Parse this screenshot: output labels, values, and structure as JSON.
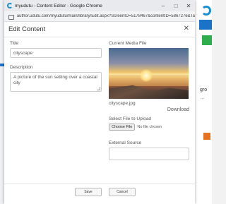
{
  "window": {
    "title": "myudutu - Content Editor - Google Chrome",
    "url": "author.udutu.com/myudutu/main/library/Edit.aspx?ScreenID=5178467&contentID=5867276&Tag..."
  },
  "dialog": {
    "title": "Edit Content",
    "title_label": "Title",
    "title_value": "cityscape",
    "description_label": "Description",
    "description_value": "A picture of the sun setting over a coastal city",
    "current_media_label": "Current Media File",
    "media_filename": "cityscape.jpg",
    "download_label": "Download",
    "upload_label": "Select File to Upload",
    "choose_file_label": "Choose File",
    "no_file_text": "No file chosen",
    "external_source_label": "External Source",
    "save_label": "Save",
    "cancel_label": "Cancel"
  },
  "background": {
    "partial_text_1": "gro",
    "partial_text_2": "..."
  },
  "colors": {
    "accent_blue": "#1a73c9",
    "brand_blue": "#1a8fd1",
    "green": "#2eae4f",
    "orange": "#e8731f"
  }
}
